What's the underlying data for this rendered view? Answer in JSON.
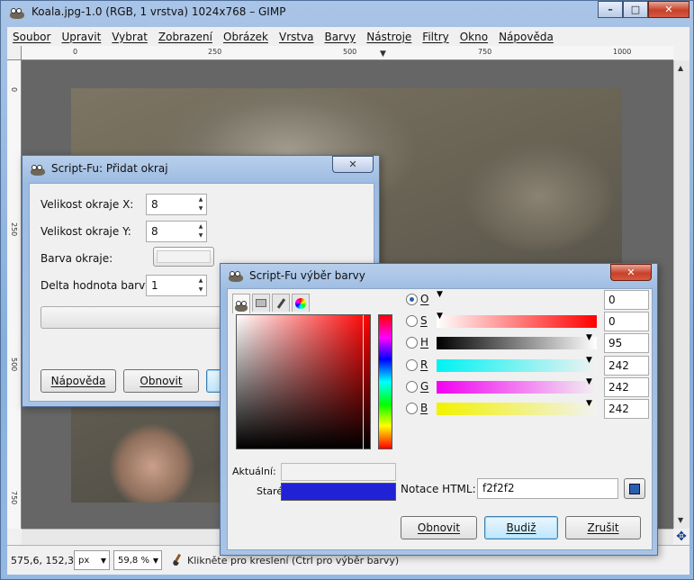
{
  "window": {
    "title": "Koala.jpg-1.0 (RGB, 1 vrstva) 1024x768 – GIMP",
    "minimize": "–",
    "maximize": "□",
    "close": "✕"
  },
  "menu": [
    "Soubor",
    "Upravit",
    "Vybrat",
    "Zobrazení",
    "Obrázek",
    "Vrstva",
    "Barvy",
    "Nástroje",
    "Filtry",
    "Okno",
    "Nápověda"
  ],
  "rulers": {
    "horizontal": [
      "0",
      "250",
      "500",
      "750",
      "1000"
    ],
    "vertical": [
      "0",
      "250",
      "500",
      "750"
    ]
  },
  "statusbar": {
    "coords": "575,6, 152,3",
    "unit": "px",
    "zoom": "59,8 %",
    "message": "Klikněte pro kreslení (Ctrl pro výběr barvy)"
  },
  "border_dialog": {
    "title": "Script-Fu: Přidat okraj",
    "fields": {
      "size_x_label": "Velikost okraje X:",
      "size_x_value": "8",
      "size_y_label": "Velikost okraje Y:",
      "size_y_value": "8",
      "color_label": "Barva okraje:",
      "delta_label": "Delta hodnota barvy:",
      "delta_value": "1"
    },
    "buttons": {
      "help": "Nápověda",
      "reset": "Obnovit"
    }
  },
  "color_dialog": {
    "title": "Script-Fu výběr barvy",
    "current_label": "Aktuální:",
    "old_label": "Staré:",
    "current_color": "#f2f2f2",
    "old_color": "#2121d6",
    "channels": [
      {
        "label": "O",
        "value": "0",
        "checked": true
      },
      {
        "label": "S",
        "value": "0",
        "checked": false
      },
      {
        "label": "H",
        "value": "95",
        "checked": false
      },
      {
        "label": "R",
        "value": "242",
        "checked": false
      },
      {
        "label": "G",
        "value": "242",
        "checked": false
      },
      {
        "label": "B",
        "value": "242",
        "checked": false
      }
    ],
    "html_label": "Notace HTML:",
    "html_value": "f2f2f2",
    "buttons": {
      "reset": "Obnovit",
      "ok": "Budiž",
      "cancel": "Zrušit"
    }
  },
  "icons": [
    "gimp-wilber-icon",
    "printer-icon",
    "pen-icon",
    "color-wheel-icon",
    "eyedropper-icon",
    "navigate-icon",
    "brush-icon"
  ]
}
